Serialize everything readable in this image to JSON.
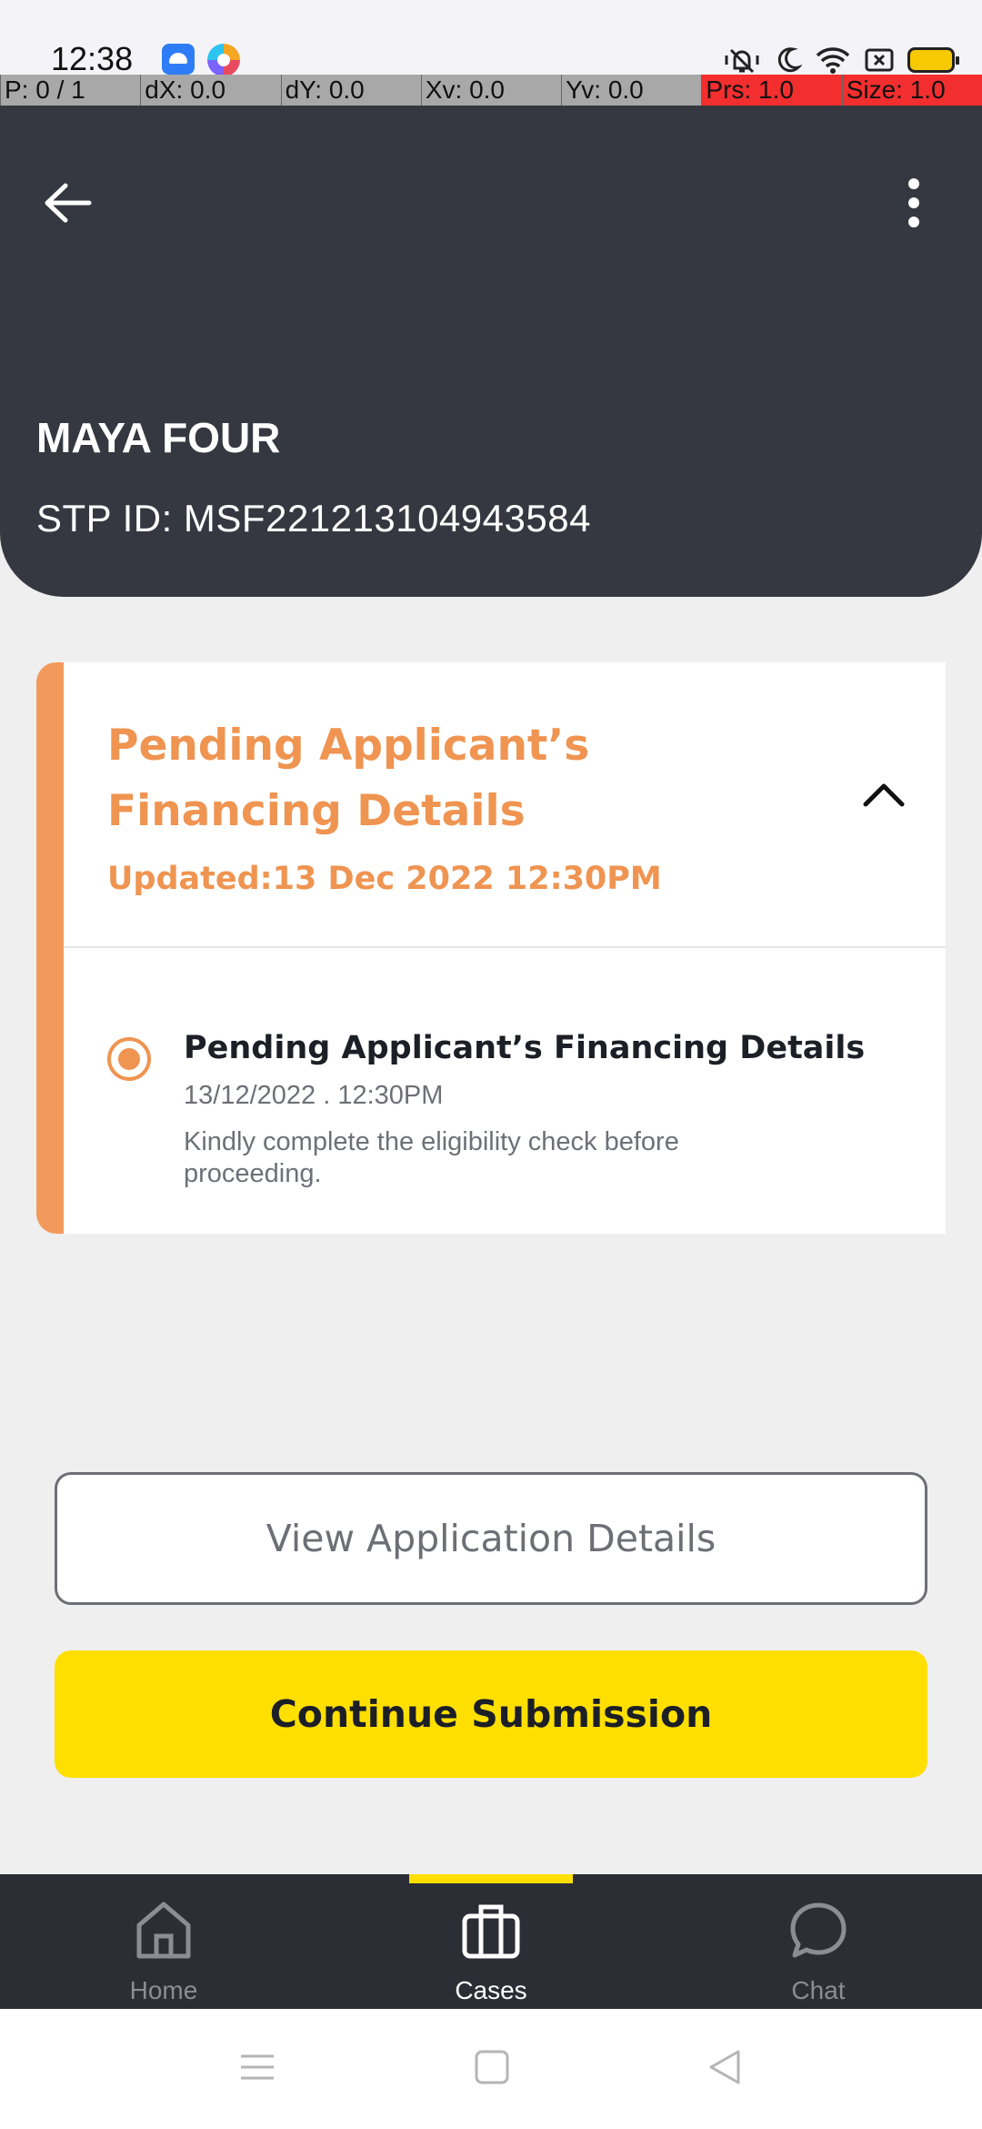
{
  "status_bar": {
    "time": "12:38",
    "icons": [
      "android-app-icon",
      "browser-app-icon",
      "mute-icon",
      "moon-icon",
      "wifi-icon",
      "screenshot-icon",
      "battery-icon"
    ]
  },
  "debug_overlay": {
    "p": "P: 0 / 1",
    "dx": "dX: 0.0",
    "dy": "dY: 0.0",
    "xv": "Xv: 0.0",
    "yv": "Yv: 0.0",
    "prs": "Prs: 1.0",
    "size": "Size: 1.0"
  },
  "header": {
    "name": "MAYA FOUR",
    "stp_id": "STP ID: MSF221213104943584"
  },
  "card": {
    "title": "Pending Applicant’s Financing Details",
    "updated": "Updated:13 Dec 2022 12:30PM",
    "step": {
      "title": "Pending Applicant’s Financing Details",
      "date": "13/12/2022 . 12:30PM",
      "description": "Kindly complete the eligibility check before proceeding."
    }
  },
  "actions": {
    "view_details": "View Application Details",
    "continue": "Continue Submission"
  },
  "bottom_nav": {
    "items": [
      {
        "label": "Home",
        "icon": "home-icon",
        "active": false
      },
      {
        "label": "Cases",
        "icon": "briefcase-icon",
        "active": true
      },
      {
        "label": "Chat",
        "icon": "chat-icon",
        "active": false
      }
    ]
  },
  "colors": {
    "header_bg": "#353840",
    "accent_orange": "#ef9451",
    "primary_yellow": "#ffdf00",
    "nav_bg": "#2b2e35"
  }
}
